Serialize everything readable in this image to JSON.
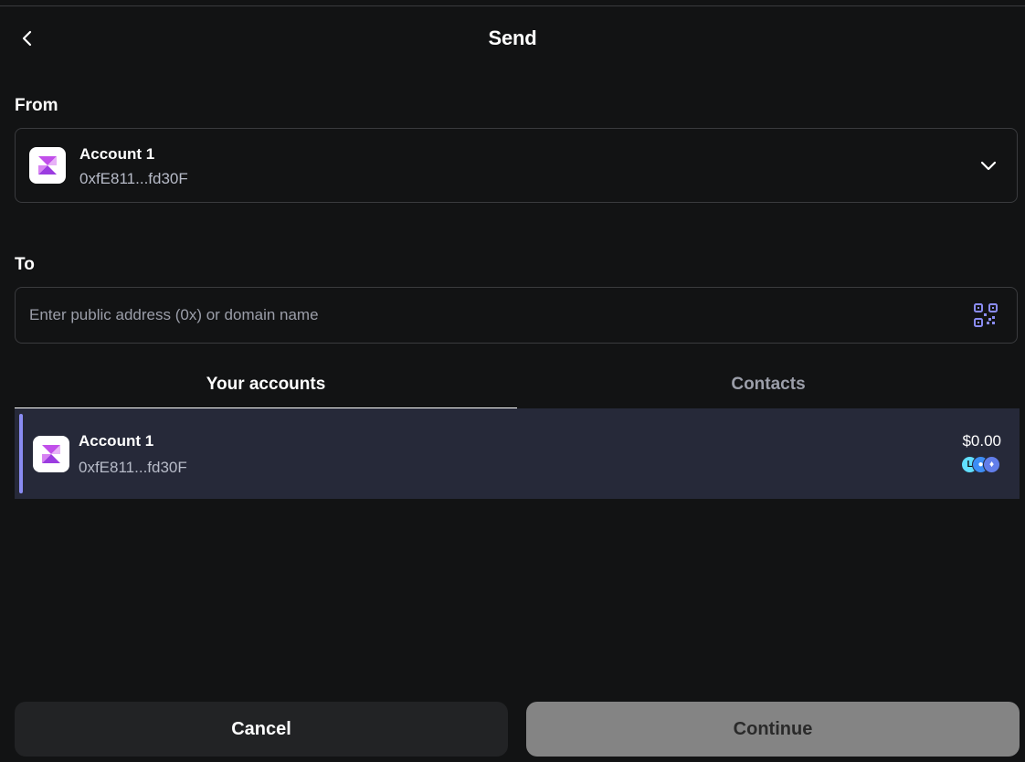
{
  "header": {
    "title": "Send"
  },
  "from": {
    "label": "From",
    "account_name": "Account 1",
    "account_address": "0xfE811...fd30F"
  },
  "to": {
    "label": "To",
    "placeholder": "Enter public address (0x) or domain name",
    "value": ""
  },
  "tabs": [
    {
      "label": "Your accounts",
      "active": true
    },
    {
      "label": "Contacts",
      "active": false
    }
  ],
  "accounts": [
    {
      "name": "Account 1",
      "address": "0xfE811...fd30F",
      "balance": "$0.00",
      "selected": true,
      "networks": [
        "linea-icon",
        "network-icon",
        "ethereum-icon"
      ]
    }
  ],
  "footer": {
    "cancel_label": "Cancel",
    "continue_label": "Continue"
  },
  "colors": {
    "background": "#121314",
    "row_highlight": "#262939",
    "accent": "#8a8cf3",
    "continue_disabled": "#848484",
    "avatar_primary": "#c14fea"
  }
}
